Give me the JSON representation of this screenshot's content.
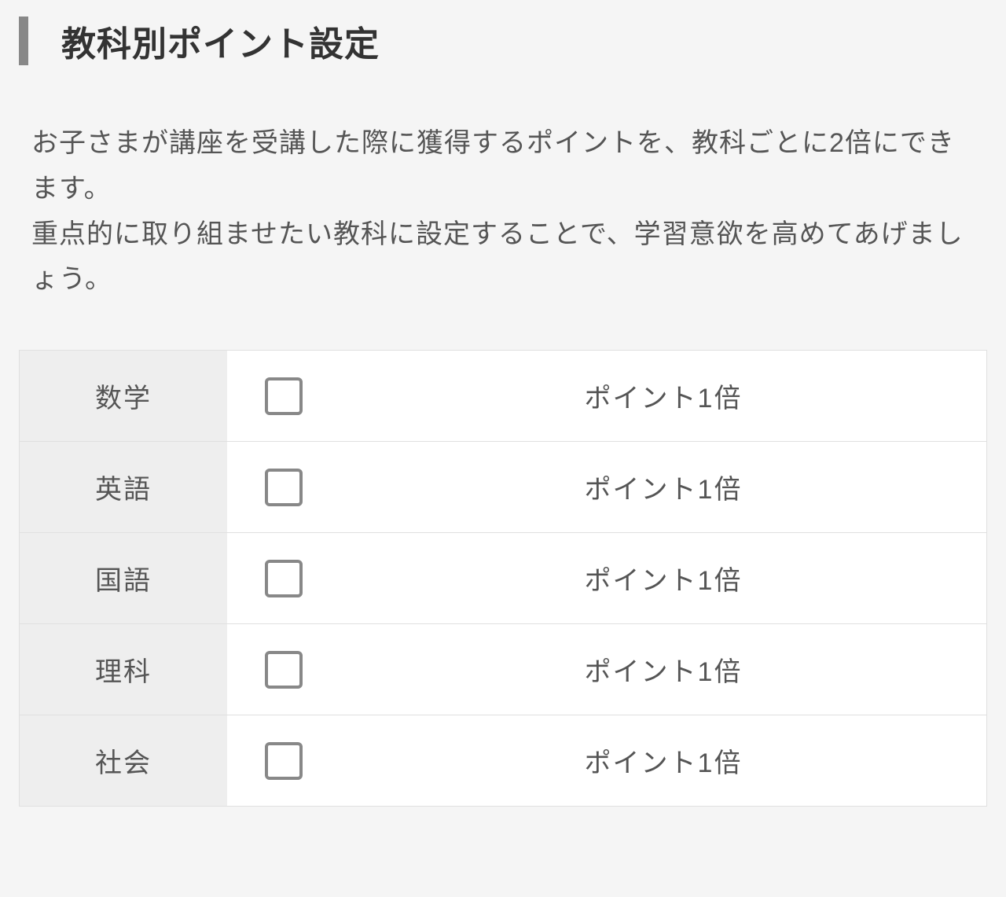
{
  "header": {
    "title": "教科別ポイント設定"
  },
  "description": {
    "line1": "お子さまが講座を受講した際に獲得するポイントを、教科ごとに2倍にできます。",
    "line2": "重点的に取り組ませたい教科に設定することで、学習意欲を高めてあげましょう。"
  },
  "subjects": [
    {
      "name": "数学",
      "status": "ポイント1倍",
      "checked": false
    },
    {
      "name": "英語",
      "status": "ポイント1倍",
      "checked": false
    },
    {
      "name": "国語",
      "status": "ポイント1倍",
      "checked": false
    },
    {
      "name": "理科",
      "status": "ポイント1倍",
      "checked": false
    },
    {
      "name": "社会",
      "status": "ポイント1倍",
      "checked": false
    }
  ]
}
